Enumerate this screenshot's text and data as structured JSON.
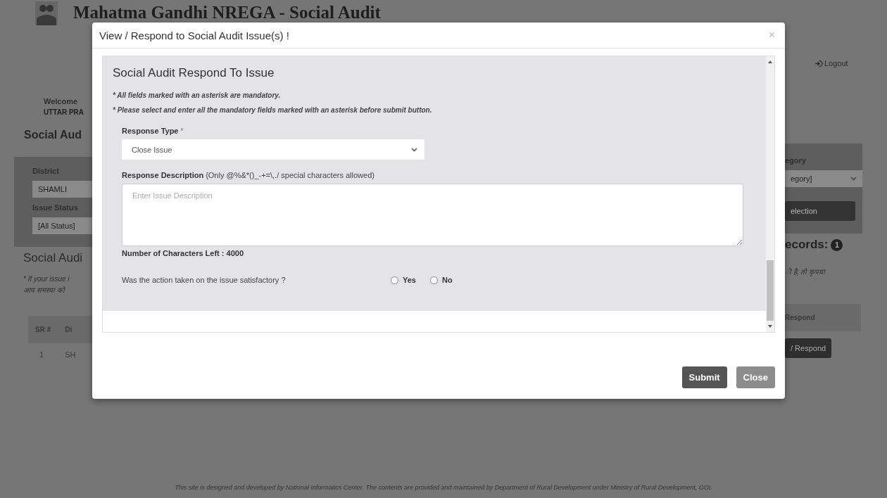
{
  "header": {
    "title": "Mahatma Gandhi NREGA - Social Audit",
    "logout": "Logout"
  },
  "background_left": {
    "welcome": "Welcome",
    "state": "UTTAR PRA",
    "heading": "Social Aud",
    "filters": [
      {
        "label": "District",
        "value": "SHAMLI"
      },
      {
        "label": "Issue Status",
        "value": "[All Status]"
      }
    ],
    "list_heading": "Social Audi",
    "note_lines": [
      "* If your issue i",
      "आप समस्या को"
    ],
    "table_header": [
      "SR #",
      "Di"
    ],
    "table_row": [
      "1",
      "SH"
    ]
  },
  "background_right": {
    "filter_label": "egory",
    "filter_value": "egory]",
    "filter_button": "election",
    "records_label": "ecords:",
    "records_count": "1",
    "note": "ी है, तो कृपया",
    "table_header": "Respond",
    "row_button": "/ Respond"
  },
  "modal": {
    "title": "View / Respond to Social Audit Issue(s) !",
    "close_symbol": "×",
    "section_title": "Social Audit Respond To Issue",
    "notes": [
      "* All fields marked with an asterisk are mandatory.",
      "* Please select and enter all the mandatory fields marked with an asterisk before submit button."
    ],
    "response_type": {
      "label": "Response Type",
      "required_mark": "*",
      "value": "Close Issue"
    },
    "response_description": {
      "label": "Response Description",
      "hint": "{Only @%&*()_-+=\\,./ special characters allowed)",
      "placeholder": "Enter Issue Description"
    },
    "characters_left": "Number of Characters Left : 4000",
    "question": "Was the action taken on the issue satisfactory ?",
    "options": [
      {
        "label": "Yes",
        "selected": false
      },
      {
        "label": "No",
        "selected": false
      }
    ],
    "buttons": [
      {
        "label": "Submit",
        "kind": "primary"
      },
      {
        "label": "Close",
        "kind": "secondary"
      }
    ]
  },
  "footer": "This site is designed and developed by National Informatics Center. The contents are provided and maintained by Department of Rural Development under Ministry of Rural Development, GOI."
}
